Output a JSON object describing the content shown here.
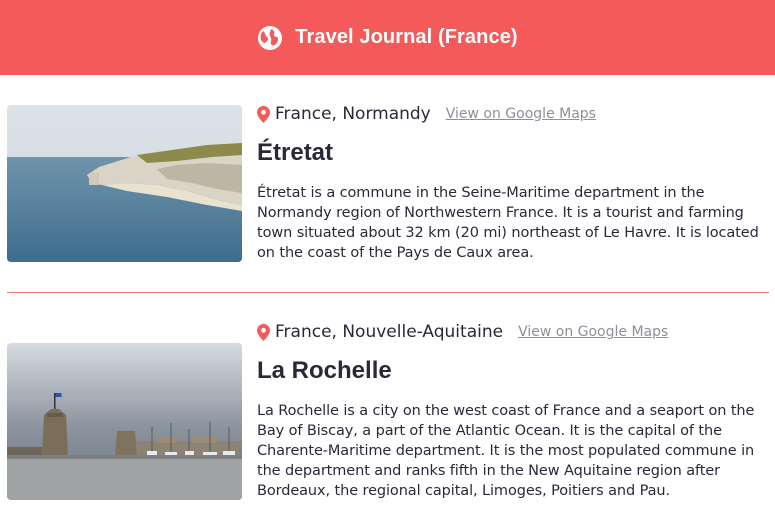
{
  "header": {
    "title": "Travel Journal (France)",
    "icon": "globe-icon"
  },
  "colors": {
    "brand": "#F55A5A",
    "text": "#2B283A",
    "link": "#918E9B"
  },
  "entries": [
    {
      "location": "France, Normandy",
      "map_link": "View on Google Maps",
      "place": "Étretat",
      "description": "Étretat is a commune in the Seine-Maritime department in the Normandy region of Northwestern France. It is a tourist and farming town situated about 32 km (20 mi) northeast of Le Havre. It is located on the coast of the Pays de Caux area."
    },
    {
      "location": "France, Nouvelle-Aquitaine",
      "map_link": "View on Google Maps",
      "place": "La Rochelle",
      "description": "La Rochelle is a city on the west coast of France and a seaport on the Bay of Biscay, a part of the Atlantic Ocean. It is the capital of the Charente-Maritime department. It is the most populated commune in the department and ranks fifth in the New Aquitaine region after Bordeaux, the regional capital, Limoges, Poitiers and Pau."
    }
  ]
}
